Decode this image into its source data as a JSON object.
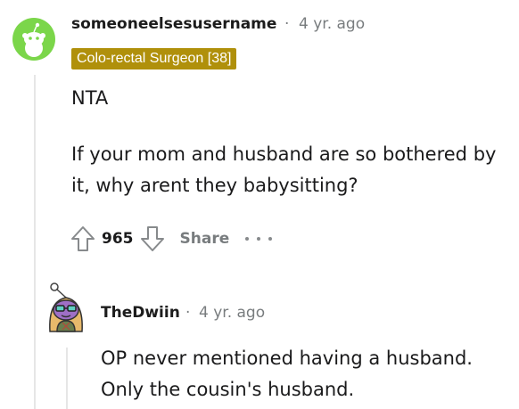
{
  "comment": {
    "username": "someoneelsesusername",
    "separator": "·",
    "age": "4 yr. ago",
    "flair": "Colo-rectal Surgeon [38]",
    "paragraphs": [
      "NTA",
      "If your mom and husband are so bothered by it, why arent they babysitting?"
    ],
    "score": "965",
    "share_label": "Share",
    "icons": {
      "upvote": "arrow-up-icon",
      "downvote": "arrow-down-icon",
      "more": "more-options-icon"
    },
    "avatar_color": "#7bd64a"
  },
  "reply": {
    "username": "TheDwiin",
    "separator": "·",
    "age": "4 yr. ago",
    "paragraphs": [
      "OP never mentioned having a husband. Only the cousin's husband."
    ],
    "avatar_color": "#9f6fc6"
  }
}
